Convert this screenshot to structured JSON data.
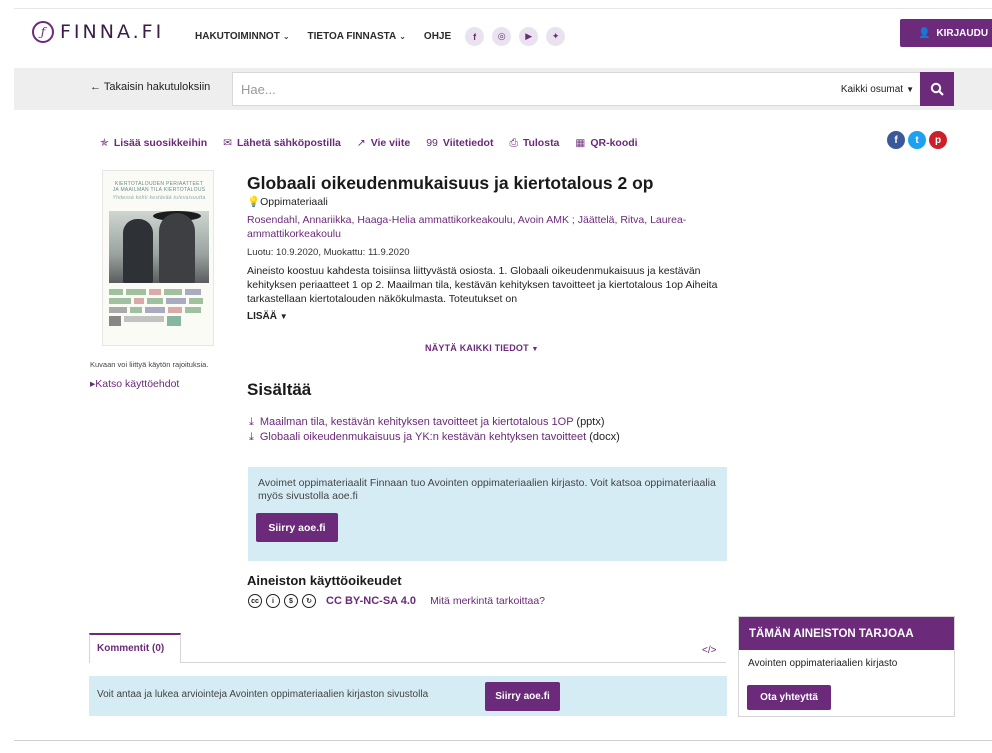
{
  "header": {
    "logo_text": "FINNA.FI",
    "nav": [
      {
        "label": "HAKUTOIMINNOT",
        "has_dropdown": true
      },
      {
        "label": "TIETOA FINNASTA",
        "has_dropdown": true
      },
      {
        "label": "OHJE",
        "has_dropdown": false
      }
    ],
    "social": [
      "facebook-icon",
      "instagram-icon",
      "youtube-icon",
      "twitter-icon"
    ],
    "login_label": "KIRJAUDU"
  },
  "search": {
    "back_label": "Takaisin hakutuloksiin",
    "placeholder": "Hae...",
    "scope": "Kaikki osumat"
  },
  "toolbar": [
    {
      "icon": "star-icon",
      "glyph": "✯",
      "label": "Lisää suosikkeihin"
    },
    {
      "icon": "mail-icon",
      "glyph": "✉",
      "label": "Lähetä sähköpostilla"
    },
    {
      "icon": "export-icon",
      "glyph": "↗",
      "label": "Vie viite"
    },
    {
      "icon": "quote-icon",
      "glyph": "99",
      "label": "Viitetiedot"
    },
    {
      "icon": "print-icon",
      "glyph": "⎙",
      "label": "Tulosta"
    },
    {
      "icon": "qr-icon",
      "glyph": "▦",
      "label": "QR-koodi"
    }
  ],
  "share": [
    {
      "icon": "facebook-share-icon",
      "glyph": "f",
      "color": "#3b5998"
    },
    {
      "icon": "twitter-share-icon",
      "glyph": "t",
      "color": "#1da1f2"
    },
    {
      "icon": "pinterest-share-icon",
      "glyph": "p",
      "color": "#cb2027"
    }
  ],
  "cover": {
    "title": "KIERTOTALOUDEN PERIAATTEET JA MAAILMAN TILA KIERTOTALOUS",
    "subtitle": "Yhdessä kohti kestävää tulevaisuutta"
  },
  "image_note": "Kuvaan voi liittyä käytön rajoituksia.",
  "terms_link": "Katso käyttöehdot",
  "record": {
    "title": "Globaali oikeudenmukaisuus ja kiertotalous 2 op",
    "type": "Oppimateriaali",
    "authors": "Rosendahl, Annariikka, Haaga-Helia ammattikorkeakoulu, Avoin AMK ; Jäättelä, Ritva, Laurea-ammattikorkeakoulu",
    "dates": "Luotu: 10.9.2020, Muokattu: 11.9.2020",
    "abstract": "Aineisto koostuu kahdesta toisiinsa liittyvästä osiosta. 1. Globaali oikeudenmukaisuus ja kestävän kehityksen periaatteet 1 op 2. Maailman tila, kestävän kehityksen tavoitteet ja kiertotalous 1op Aiheita tarkastellaan kiertotalouden näkökulmasta. Toteutukset on",
    "more_label": "LISÄÄ",
    "show_all_label": "NÄYTÄ KAIKKI TIEDOT"
  },
  "contains": {
    "heading": "Sisältää",
    "files": [
      {
        "name": "Maailman tila, kestävän kehityksen tavoitteet ja kiertotalous 1OP",
        "ext": "(pptx)"
      },
      {
        "name": "Globaali oikeudenmukaisuus ja YK:n kestävän kehtyksen tavoitteet",
        "ext": "(docx)"
      }
    ]
  },
  "aoe": {
    "text": "Avoimet oppimateriaalit Finnaan tuo Avointen oppimateriaalien kirjasto. Voit katsoa oppimateriaalia myös sivustolla aoe.fi",
    "button": "Siirry aoe.fi"
  },
  "rights": {
    "heading": "Aineiston käyttöoikeudet",
    "license": "CC BY-NC-SA 4.0",
    "what_link": "Mitä merkintä tarkoittaa?",
    "icons": [
      "cc-icon",
      "by-icon",
      "nc-icon",
      "sa-icon"
    ]
  },
  "comments": {
    "tab_label": "Kommentit (0)",
    "embed_glyph": "</>",
    "text": "Voit antaa ja lukea arviointeja Avointen oppimateriaalien kirjaston sivustolla",
    "button": "Siirry aoe.fi"
  },
  "provider": {
    "heading": "TÄMÄN AINEISTON TARJOAA",
    "name": "Avointen oppimateriaalien kirjasto",
    "button": "Ota yhteyttä"
  },
  "colors": {
    "brand": "#6b2a7a",
    "info_bg": "#d6ecf5"
  }
}
